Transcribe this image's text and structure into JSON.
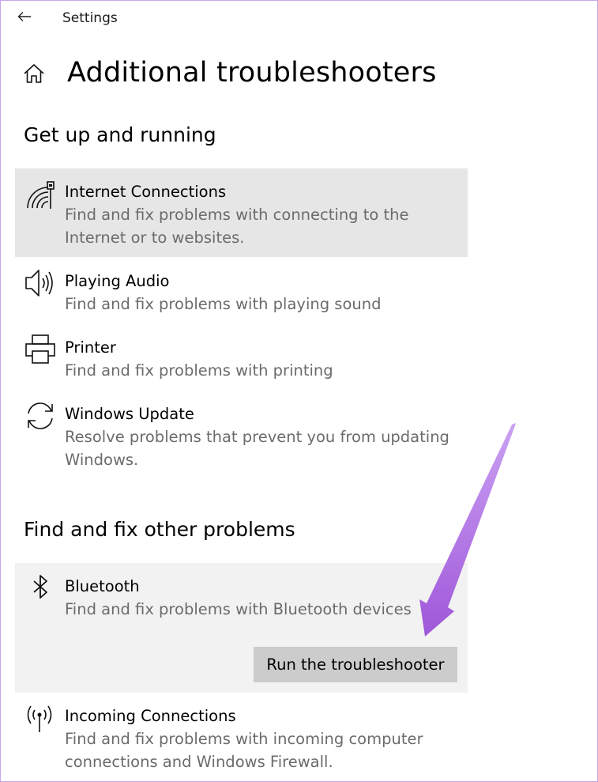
{
  "window": {
    "app_title": "Settings",
    "back_icon": "back-arrow-icon"
  },
  "header": {
    "home_icon": "home-icon",
    "title": "Additional troubleshooters"
  },
  "sections": {
    "get_up_and_running": {
      "title": "Get up and running",
      "items": [
        {
          "icon": "network-icon",
          "name": "Internet Connections",
          "description": "Find and fix problems with connecting to the Internet or to websites.",
          "state": "selected"
        },
        {
          "icon": "speaker-icon",
          "name": "Playing Audio",
          "description": "Find and fix problems with playing sound"
        },
        {
          "icon": "printer-icon",
          "name": "Printer",
          "description": "Find and fix problems with printing"
        },
        {
          "icon": "sync-icon",
          "name": "Windows Update",
          "description": "Resolve problems that prevent you from updating Windows."
        }
      ]
    },
    "find_and_fix_other": {
      "title": "Find and fix other problems",
      "items": [
        {
          "icon": "bluetooth-icon",
          "name": "Bluetooth",
          "description": "Find and fix problems with Bluetooth devices",
          "state": "expanded",
          "action_label": "Run the troubleshooter"
        },
        {
          "icon": "antenna-icon",
          "name": "Incoming Connections",
          "description": "Find and fix problems with incoming computer connections and Windows Firewall."
        }
      ]
    }
  },
  "colors": {
    "selected_bg": "#e6e6e6",
    "expanded_bg": "#f2f2f2",
    "button_bg": "#cccccc",
    "secondary_text": "#6b6b6b",
    "annotation_arrow": "#b06be6"
  }
}
